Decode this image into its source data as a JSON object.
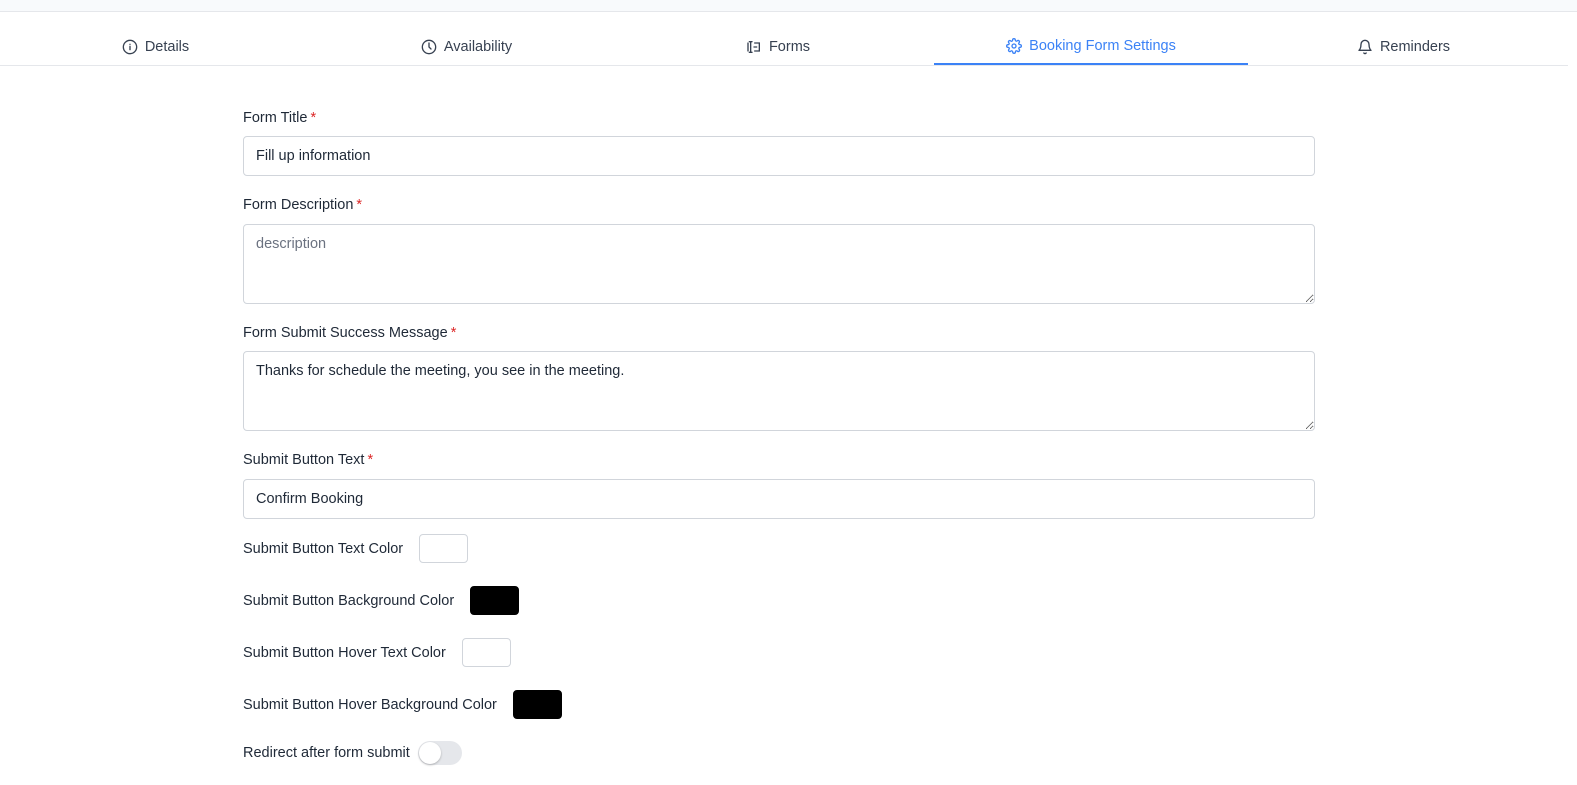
{
  "tabs": [
    {
      "label": "Details",
      "icon": "info-icon",
      "active": false
    },
    {
      "label": "Availability",
      "icon": "clock-icon",
      "active": false
    },
    {
      "label": "Forms",
      "icon": "form-input-icon",
      "active": false
    },
    {
      "label": "Booking Form Settings",
      "icon": "gear-icon",
      "active": true
    },
    {
      "label": "Reminders",
      "icon": "bell-icon",
      "active": false
    }
  ],
  "colors": {
    "accent": "#3b82f6",
    "required": "#dc2626",
    "submit_text_color": "#ffffff",
    "submit_bg_color": "#000000",
    "hover_text_color": "#ffffff",
    "hover_bg_color": "#000000"
  },
  "form": {
    "title": {
      "label": "Form Title",
      "required_mark": "*",
      "value": "Fill up information"
    },
    "description": {
      "label": "Form Description",
      "required_mark": "*",
      "value": "",
      "placeholder": "description"
    },
    "success_message": {
      "label": "Form Submit Success Message",
      "required_mark": "*",
      "value": "Thanks for schedule the meeting, you see in the meeting."
    },
    "submit_text": {
      "label": "Submit Button Text",
      "required_mark": "*",
      "value": "Confirm Booking"
    },
    "submit_text_color_label": "Submit Button Text Color",
    "submit_bg_color_label": "Submit Button Background Color",
    "hover_text_color_label": "Submit Button Hover Text Color",
    "hover_bg_color_label": "Submit Button Hover Background Color",
    "redirect": {
      "label": "Redirect after form submit",
      "enabled": false
    }
  }
}
